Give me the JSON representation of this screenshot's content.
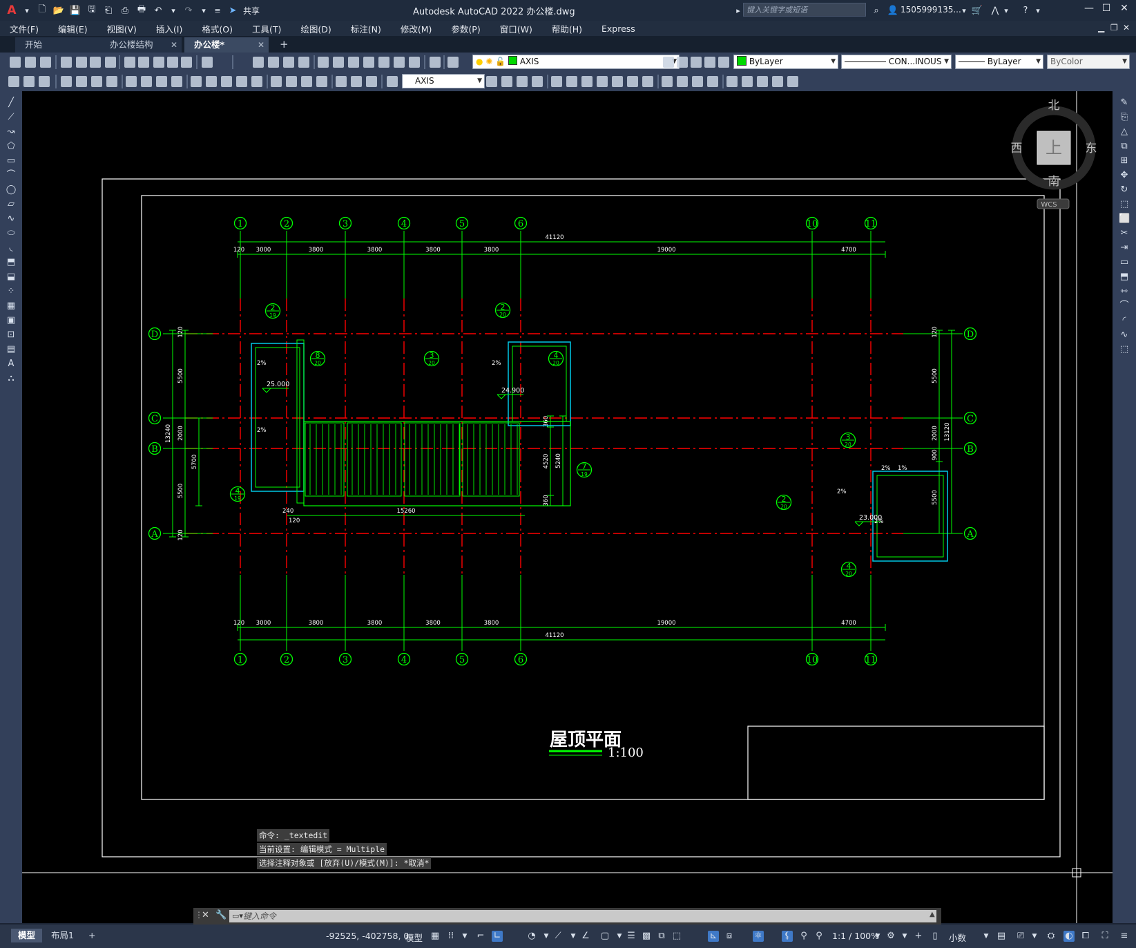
{
  "window": {
    "app_title": "Autodesk AutoCAD 2022    办公楼.dwg",
    "share_label": "共享",
    "search_placeholder": "键入关键字或短语",
    "user_name": "1505999135...",
    "logo": "A"
  },
  "menu": [
    "文件(F)",
    "编辑(E)",
    "视图(V)",
    "插入(I)",
    "格式(O)",
    "工具(T)",
    "绘图(D)",
    "标注(N)",
    "修改(M)",
    "参数(P)",
    "窗口(W)",
    "帮助(H)",
    "Express"
  ],
  "tabs": [
    {
      "label": "开始",
      "closable": false
    },
    {
      "label": "办公楼结构",
      "closable": true
    },
    {
      "label": "办公楼*",
      "closable": true,
      "active": true
    }
  ],
  "toolbar": {
    "layer_name": "AXIS",
    "color": "ByLayer",
    "linetype": "CON...INOUS",
    "lineweight": "ByLayer",
    "plotstyle": "ByColor",
    "dimstyle": "AXIS"
  },
  "viewcube": {
    "north": "北",
    "south": "南",
    "east": "东",
    "west": "西",
    "top": "上",
    "wcs": "WCS"
  },
  "drawing": {
    "title": "屋顶平面",
    "scale": "1:100",
    "columns": [
      "1",
      "2",
      "3",
      "4",
      "5",
      "6",
      "10",
      "11"
    ],
    "rows": [
      "D",
      "C",
      "B",
      "A"
    ],
    "top_dims": [
      "120",
      "3000",
      "3800",
      "3800",
      "3800",
      "3800",
      "19000",
      "4700"
    ],
    "total_dim": "41120",
    "bottom_dims": [
      "120",
      "3000",
      "3800",
      "3800",
      "3800",
      "3800",
      "19000",
      "4700"
    ],
    "left_dims": [
      "120",
      "5500",
      "2000",
      "5500",
      "120"
    ],
    "left_total": "13240",
    "left_sub": "5700",
    "right_dims": [
      "120",
      "5500",
      "2000",
      "900",
      "5500"
    ],
    "right_total": "13120",
    "canopy_dims": [
      "360",
      "4520",
      "5240",
      "360"
    ],
    "bottom_small": [
      "240",
      "120",
      "15260"
    ],
    "elevations": [
      "25.000",
      "24.900",
      "23.000"
    ],
    "slopes": [
      "2%",
      "2%",
      "2%",
      "2%",
      "1%",
      "2%",
      "2%"
    ],
    "callouts": [
      {
        "n": "2",
        "d": "19"
      },
      {
        "n": "8",
        "d": "20"
      },
      {
        "n": "4",
        "d": "19"
      },
      {
        "n": "2",
        "d": "20"
      },
      {
        "n": "3",
        "d": "20"
      },
      {
        "n": "4",
        "d": "20"
      },
      {
        "n": "7",
        "d": "19"
      },
      {
        "n": "3",
        "d": "20"
      },
      {
        "n": "2",
        "d": "20"
      },
      {
        "n": "4",
        "d": "20"
      }
    ]
  },
  "command": {
    "history": [
      "命令: _textedit",
      "当前设置: 编辑模式 = Multiple",
      "选择注释对象或 [放弃(U)/模式(M)]: *取消*"
    ],
    "placeholder": "键入命令"
  },
  "status": {
    "tabs": [
      "模型",
      "布局1"
    ],
    "coords": "-92525, -402758, 0",
    "model_label": "模型",
    "scale": "1:1 / 100%",
    "units": "小数"
  },
  "colors": {
    "canvas": "#000000",
    "green": "#00ff00",
    "red": "#ff0000",
    "cyan": "#00c8e6",
    "white": "#ffffff"
  }
}
